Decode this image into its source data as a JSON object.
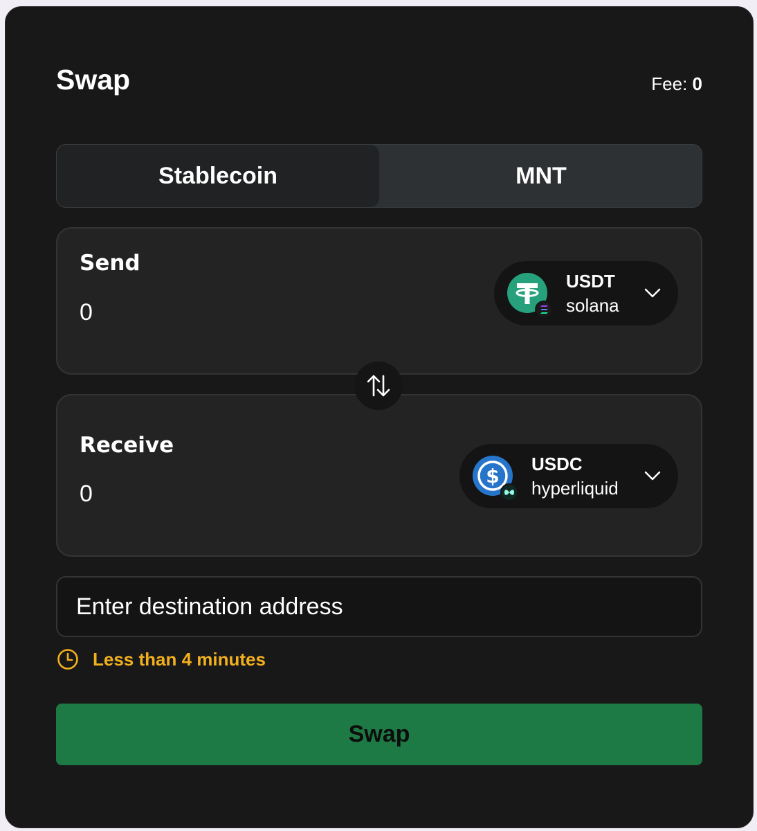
{
  "header": {
    "title": "Swap",
    "fee_label": "Fee:",
    "fee_value": "0"
  },
  "tabs": [
    {
      "label": "Stablecoin",
      "active": true
    },
    {
      "label": "MNT",
      "active": false
    }
  ],
  "send": {
    "label": "Send",
    "amount": "0",
    "token": {
      "symbol": "USDT",
      "chain": "solana",
      "icon": "tether-icon",
      "chain_icon": "solana-icon",
      "color": "#26a17b"
    }
  },
  "receive": {
    "label": "Receive",
    "amount": "0",
    "token": {
      "symbol": "USDC",
      "chain": "hyperliquid",
      "icon": "usdc-icon",
      "chain_icon": "hyperliquid-icon",
      "color": "#2775ca"
    }
  },
  "swap_direction_icon": "swap-arrows-icon",
  "destination": {
    "placeholder": "Enter destination address",
    "value": ""
  },
  "eta": {
    "icon": "clock-icon",
    "text": "Less than 4 minutes",
    "color": "#f2b01e"
  },
  "submit": {
    "label": "Swap",
    "color": "#1d7a45"
  }
}
